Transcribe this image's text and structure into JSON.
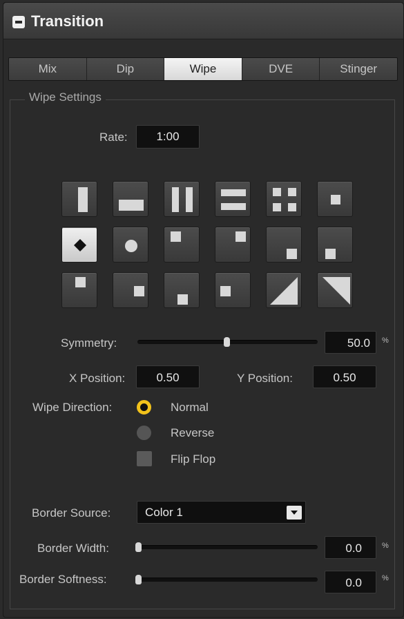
{
  "panel": {
    "title": "Transition"
  },
  "tabs": [
    {
      "label": "Mix"
    },
    {
      "label": "Dip"
    },
    {
      "label": "Wipe",
      "active": true
    },
    {
      "label": "DVE"
    },
    {
      "label": "Stinger"
    }
  ],
  "wipe_settings": {
    "group_label": "Wipe Settings",
    "rate_label": "Rate:",
    "rate_value": "1:00",
    "patterns": [
      {
        "name": "vertical-bar"
      },
      {
        "name": "horizontal-bar"
      },
      {
        "name": "vertical-barn-door"
      },
      {
        "name": "horizontal-barn-door"
      },
      {
        "name": "corners-in-four-box"
      },
      {
        "name": "iris-box"
      },
      {
        "name": "diamond-iris",
        "selected": true
      },
      {
        "name": "circle-iris"
      },
      {
        "name": "box-top-left"
      },
      {
        "name": "box-top-right"
      },
      {
        "name": "box-bottom-right"
      },
      {
        "name": "box-bottom-left"
      },
      {
        "name": "box-top-center"
      },
      {
        "name": "box-right-center"
      },
      {
        "name": "box-bottom-center"
      },
      {
        "name": "box-left-center"
      },
      {
        "name": "diagonal-top-right"
      },
      {
        "name": "diagonal-top-left"
      }
    ],
    "symmetry_label": "Symmetry:",
    "symmetry_value": "50.0",
    "symmetry_level": 0.5,
    "percent_sign": "%",
    "x_position_label": "X Position:",
    "x_position_value": "0.50",
    "y_position_label": "Y Position:",
    "y_position_value": "0.50",
    "wipe_direction_label": "Wipe Direction:",
    "direction_normal": "Normal",
    "direction_reverse": "Reverse",
    "flip_flop": "Flip Flop",
    "selected_direction": "Normal",
    "border_source_label": "Border Source:",
    "border_source_value": "Color 1",
    "border_width_label": "Border Width:",
    "border_width_value": "0.0",
    "border_width_level": 0.0,
    "border_softness_label": "Border Softness:",
    "border_softness_value": "0.0",
    "border_softness_level": 0.0
  },
  "colors": {
    "accent": "#f2c21b",
    "panel_bg": "#2a2a2a",
    "field_bg": "#101010"
  }
}
